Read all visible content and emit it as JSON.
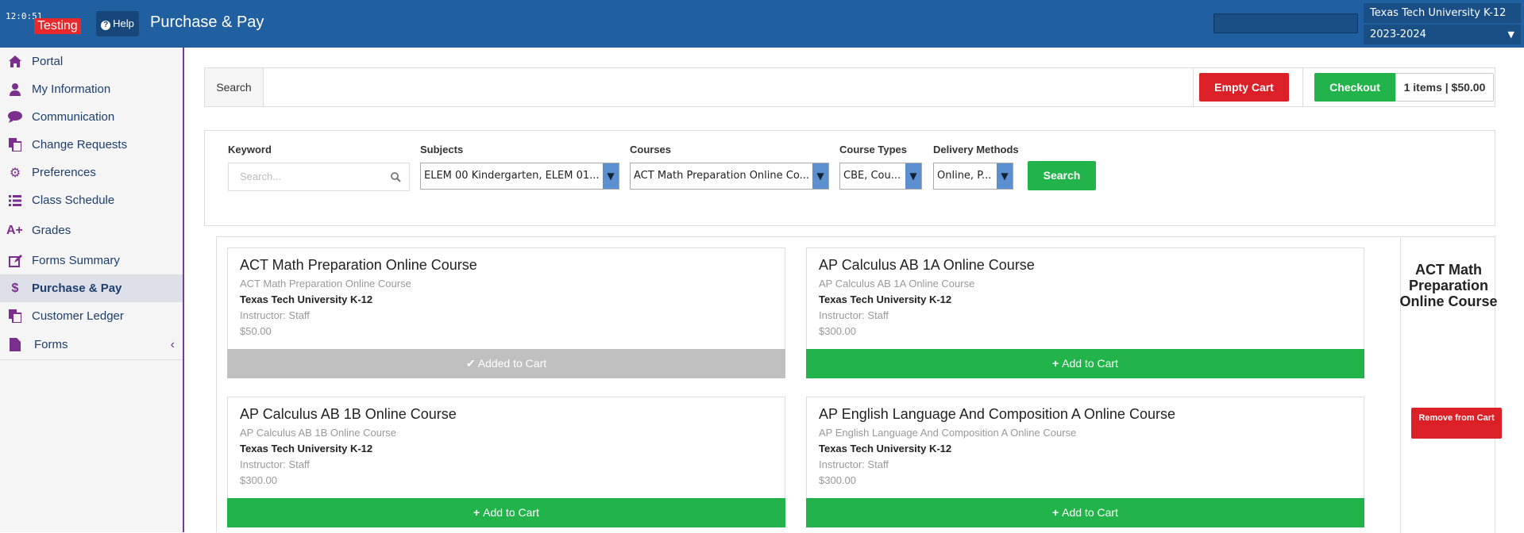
{
  "topbar": {
    "clock": "12:0:51",
    "env_badge": "Testing",
    "help_label": "Help",
    "app_title": "Purchase & Pay",
    "org_select": "Texas Tech University K-12",
    "year_select": "2023-2024"
  },
  "sidebar": {
    "items": [
      {
        "label": "Portal",
        "icon": "home-icon"
      },
      {
        "label": "My Information",
        "icon": "user-icon"
      },
      {
        "label": "Communication",
        "icon": "comment-icon"
      },
      {
        "label": "Change Requests",
        "icon": "copy-icon"
      },
      {
        "label": "Preferences",
        "icon": "gear-icon"
      },
      {
        "label": "Class Schedule",
        "icon": "list-icon"
      },
      {
        "label": "Grades",
        "icon": "aplus-icon"
      },
      {
        "label": "Forms Summary",
        "icon": "edit-icon"
      },
      {
        "label": "Purchase & Pay",
        "icon": "dollar-icon"
      },
      {
        "label": "Customer Ledger",
        "icon": "copy-icon"
      },
      {
        "label": "Forms",
        "icon": "file-icon"
      }
    ],
    "active": "Purchase & Pay"
  },
  "cartbar": {
    "search_tab": "Search",
    "empty_cart": "Empty Cart",
    "checkout": "Checkout",
    "cart_summary": "1 items | $50.00"
  },
  "filters": {
    "keyword_label": "Keyword",
    "keyword_placeholder": "Search...",
    "subjects_label": "Subjects",
    "subjects_value": "ELEM 00 Kindergarten, ELEM 01...",
    "courses_label": "Courses",
    "courses_value": "ACT Math Preparation Online Co...",
    "course_types_label": "Course Types",
    "course_types_value": "CBE, Cou...",
    "delivery_label": "Delivery Methods",
    "delivery_value": "Online, P...",
    "search_button": "Search"
  },
  "courses": [
    {
      "title": "ACT Math Preparation Online Course",
      "subtitle": "ACT Math Preparation Online Course",
      "org": "Texas Tech University K-12",
      "instructor": "Instructor: Staff",
      "price": "$50.00",
      "button": "Added to Cart",
      "added": true
    },
    {
      "title": "AP Calculus AB 1A Online Course",
      "subtitle": "AP Calculus AB 1A Online Course",
      "org": "Texas Tech University K-12",
      "instructor": "Instructor: Staff",
      "price": "$300.00",
      "button": "Add to Cart",
      "added": false
    },
    {
      "title": "AP Calculus AB 1B Online Course",
      "subtitle": "AP Calculus AB 1B Online Course",
      "org": "Texas Tech University K-12",
      "instructor": "Instructor: Staff",
      "price": "$300.00",
      "button": "Add to Cart",
      "added": false
    },
    {
      "title": "AP English Language And Composition A Online Course",
      "subtitle": "AP English Language And Composition A Online Course",
      "org": "Texas Tech University K-12",
      "instructor": "Instructor: Staff",
      "price": "$300.00",
      "button": "Add to Cart",
      "added": false
    }
  ],
  "cart_side": {
    "item_title": "ACT Math Preparation Online Course",
    "remove_label": "Remove from Cart"
  },
  "colors": {
    "header": "#2160a0",
    "green": "#22b44a",
    "red": "#dc2028",
    "sidebar_icon": "#7b2f8d"
  }
}
